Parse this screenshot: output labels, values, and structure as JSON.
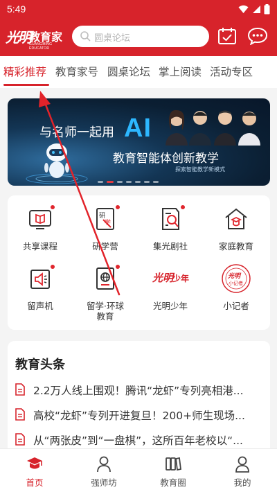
{
  "status_bar": {
    "time": "5:49"
  },
  "header": {
    "logo": {
      "mark": "光明",
      "name": "教育家",
      "subtitle": "GUANGMING EDUCATOR"
    },
    "search_placeholder": "圆桌论坛",
    "icons": [
      "calendar-check-icon",
      "chat-more-icon"
    ]
  },
  "tabs": [
    {
      "label": "精彩推荐",
      "active": true
    },
    {
      "label": "教育家号",
      "active": false
    },
    {
      "label": "圆桌论坛",
      "active": false
    },
    {
      "label": "掌上阅读",
      "active": false
    },
    {
      "label": "活动专区",
      "active": false
    }
  ],
  "banner": {
    "line1": "与名师一起用",
    "highlight": "AI",
    "line2": "教育智能体创新教学",
    "line3": "探索智能教学新模式",
    "slide_index": 1,
    "slide_count": 7
  },
  "features": [
    {
      "label": "共享课程",
      "icon": "course-screen-icon",
      "badge": true
    },
    {
      "label": "研学营",
      "icon": "study-camp-icon",
      "badge": true
    },
    {
      "label": "集光剧社",
      "icon": "drama-club-icon",
      "badge": true
    },
    {
      "label": "家庭教育",
      "icon": "family-education-icon",
      "badge": false
    },
    {
      "label": "留声机",
      "icon": "gramophone-icon",
      "badge": true
    },
    {
      "label": "留学·环球\n教育",
      "icon": "passport-globe-icon",
      "badge": true
    },
    {
      "label": "光明少年",
      "icon": "guangming-youth-logo-icon",
      "badge": false
    },
    {
      "label": "小记者",
      "icon": "little-reporter-logo-icon",
      "badge": false
    }
  ],
  "news": {
    "title": "教育头条",
    "items": [
      "2.2万人线上围观！腾讯“龙虾”专列亮相港...",
      "高校“龙虾”专列开进复旦！200+师生现场...",
      "从“两张皮”到“一盘棋”，这所百年老校以“..."
    ]
  },
  "bottom_nav": [
    {
      "label": "首页",
      "icon": "graduation-cap-icon",
      "active": true
    },
    {
      "label": "强师坊",
      "icon": "person-icon",
      "active": false
    },
    {
      "label": "教育圈",
      "icon": "books-icon",
      "active": false
    },
    {
      "label": "我的",
      "icon": "user-profile-icon",
      "active": false
    }
  ],
  "colors": {
    "brand": "#d7232b",
    "badge": "#e0262d",
    "banner_accent": "#2db7ff"
  }
}
